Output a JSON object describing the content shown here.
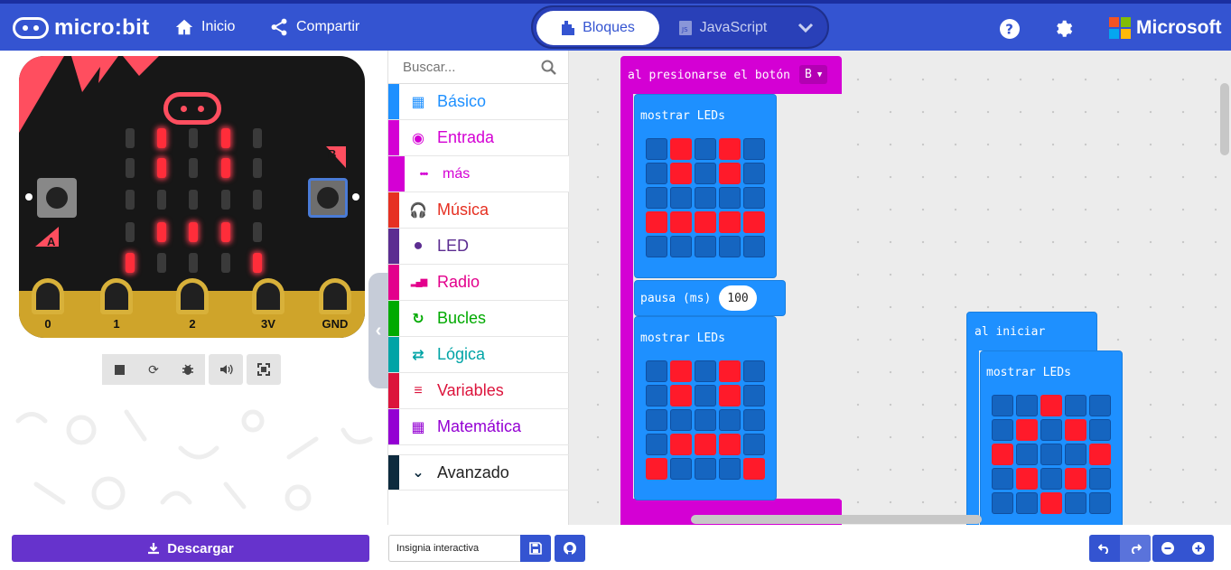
{
  "header": {
    "brand": "micro:bit",
    "home_label": "Inicio",
    "share_label": "Compartir",
    "mode_blocks": "Bloques",
    "mode_js": "JavaScript",
    "ms_label": "Microsoft"
  },
  "simulator": {
    "label_a": "A",
    "label_b": "B",
    "pins": [
      "0",
      "1",
      "2",
      "3V",
      "GND"
    ],
    "leds_on": [
      [
        1,
        0
      ],
      [
        3,
        0
      ],
      [
        1,
        1
      ],
      [
        3,
        1
      ],
      [
        1,
        3
      ],
      [
        2,
        3
      ],
      [
        3,
        3
      ],
      [
        0,
        4
      ],
      [
        4,
        4
      ]
    ]
  },
  "toolbox": {
    "search_placeholder": "Buscar...",
    "categories": [
      {
        "label": "Básico",
        "color": "#1e90ff",
        "icon": "grid-icon"
      },
      {
        "label": "Entrada",
        "color": "#d400d4",
        "icon": "target-icon"
      },
      {
        "label": "más",
        "color": "#d400d4",
        "icon": "more-icon"
      },
      {
        "label": "Música",
        "color": "#e63022",
        "icon": "headphones-icon"
      },
      {
        "label": "LED",
        "color": "#5c2d91",
        "icon": "toggle-icon"
      },
      {
        "label": "Radio",
        "color": "#e3008c",
        "icon": "signal-icon"
      },
      {
        "label": "Bucles",
        "color": "#00aa00",
        "icon": "loop-icon"
      },
      {
        "label": "Lógica",
        "color": "#00a4a6",
        "icon": "shuffle-icon"
      },
      {
        "label": "Variables",
        "color": "#dc143c",
        "icon": "lines-icon"
      },
      {
        "label": "Matemática",
        "color": "#9400d3",
        "icon": "calculator-icon"
      },
      {
        "label": "Avanzado",
        "color": "#0d2b3e",
        "icon": "chevron-down-icon"
      }
    ]
  },
  "workspace": {
    "event_label": "al presionarse el botón",
    "event_button": "B",
    "show_leds_1": "mostrar LEDs",
    "pause_label": "pausa (ms)",
    "pause_value": "100",
    "show_leds_2": "mostrar LEDs",
    "start_label": "al iniciar",
    "show_leds_3": "mostrar LEDs",
    "grid1": [
      0,
      1,
      0,
      1,
      0,
      0,
      1,
      0,
      1,
      0,
      0,
      0,
      0,
      0,
      0,
      1,
      1,
      1,
      1,
      1,
      0,
      0,
      0,
      0,
      0
    ],
    "grid2": [
      0,
      1,
      0,
      1,
      0,
      0,
      1,
      0,
      1,
      0,
      0,
      0,
      0,
      0,
      0,
      0,
      1,
      1,
      1,
      0,
      1,
      0,
      0,
      0,
      1
    ],
    "grid3": [
      0,
      0,
      1,
      0,
      0,
      0,
      1,
      0,
      1,
      0,
      1,
      0,
      0,
      0,
      1,
      0,
      1,
      0,
      1,
      0,
      0,
      0,
      1,
      0,
      0
    ]
  },
  "footer": {
    "download_label": "Descargar",
    "project_name": "Insignia interactiva"
  }
}
